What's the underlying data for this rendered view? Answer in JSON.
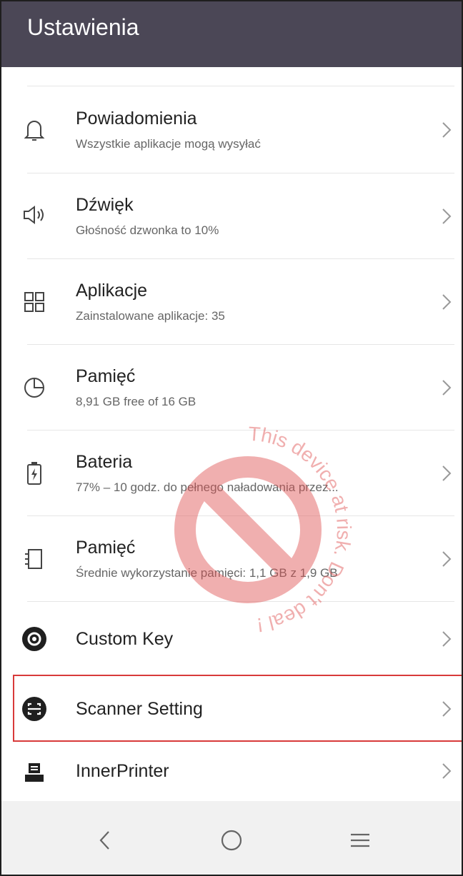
{
  "header": {
    "title": "Ustawienia"
  },
  "settings": {
    "items": [
      {
        "title": "Powiadomienia",
        "subtitle": "Wszystkie aplikacje mogą wysyłać",
        "icon": "bell-icon"
      },
      {
        "title": "Dźwięk",
        "subtitle": "Głośność dzwonka to 10%",
        "icon": "speaker-icon"
      },
      {
        "title": "Aplikacje",
        "subtitle": "Zainstalowane aplikacje: 35",
        "icon": "apps-grid-icon"
      },
      {
        "title": "Pamięć",
        "subtitle": "8,91 GB free of 16 GB",
        "icon": "pie-chart-icon"
      },
      {
        "title": "Bateria",
        "subtitle": "77% – 10 godz. do pełnego naładowania przez...",
        "icon": "battery-icon"
      },
      {
        "title": "Pamięć",
        "subtitle": "Średnie wykorzystanie pamięci: 1,1 GB z 1,9 GB",
        "icon": "memory-chip-icon"
      },
      {
        "title": "Custom Key",
        "icon": "gear-icon"
      },
      {
        "title": "Scanner Setting",
        "icon": "scanner-icon"
      },
      {
        "title": "InnerPrinter",
        "icon": "printer-icon"
      }
    ]
  },
  "watermark": {
    "text": "This device at risk. Don't deal !",
    "color": "#e05050"
  },
  "navbar": {
    "back_icon": "back-icon",
    "home_icon": "home-icon",
    "menu_icon": "menu-icon"
  },
  "colors": {
    "header_bg": "#4b4756",
    "highlight": "#d83a3a"
  }
}
